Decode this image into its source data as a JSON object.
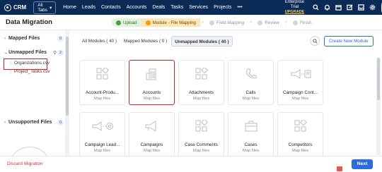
{
  "topbar": {
    "app_name": "CRM",
    "all_tabs_label": "All Tabs",
    "nav_items": [
      "Home",
      "Leads",
      "Contacts",
      "Accounts",
      "Deals",
      "Tasks",
      "Services",
      "Projects",
      "•••"
    ],
    "trial_label": "Enterprise Trial",
    "upgrade_label": "UPGRADE",
    "icons": [
      "search-icon",
      "bell-icon",
      "calendar-icon",
      "compose-icon",
      "inbox-icon",
      "gear-icon",
      "avatar",
      "apps-grid-icon"
    ]
  },
  "page": {
    "title": "Data Migration"
  },
  "steps": [
    {
      "label": "Upload",
      "state": "done"
    },
    {
      "label": "Module - File Mapping",
      "state": "current"
    },
    {
      "label": "Field Mapping",
      "state": "pending"
    },
    {
      "label": "Review",
      "state": "pending"
    },
    {
      "label": "Finish",
      "state": "pending"
    }
  ],
  "sidebar": {
    "mapped": {
      "label": "Mapped Files",
      "count": "0"
    },
    "unmapped": {
      "label": "Unmapped Files",
      "count": "2"
    },
    "unmapped_files": [
      "Organizations.csv",
      "Project_Tasks.csv"
    ],
    "unsupported": {
      "label": "Unsupported Files",
      "count": "0"
    }
  },
  "filters": {
    "all": "All Modules ( 40 )",
    "mapped": "Mapped Modules ( 0 )",
    "unmapped": "Unmapped Modules ( 40 )"
  },
  "create_button": "Create New Module",
  "modules": [
    {
      "name": "Account-Produ...",
      "sub": "Map files",
      "icon": "grid-blocks-icon"
    },
    {
      "name": "Accounts",
      "sub": "Map files",
      "icon": "building-icon"
    },
    {
      "name": "Attachments",
      "sub": "Map files",
      "icon": "grid-blocks-icon"
    },
    {
      "name": "Calls",
      "sub": "Map files",
      "icon": "phone-icon"
    },
    {
      "name": "Campaign Cont...",
      "sub": "Map files",
      "icon": "campaign-contact-icon"
    },
    {
      "name": "Campaign Lead...",
      "sub": "Map files",
      "icon": "campaign-lead-icon"
    },
    {
      "name": "Campaigns",
      "sub": "Map files",
      "icon": "megaphone-icon"
    },
    {
      "name": "Case Comments",
      "sub": "Map files",
      "icon": "grid-blocks-icon"
    },
    {
      "name": "Cases",
      "sub": "Map files",
      "icon": "briefcase-icon"
    },
    {
      "name": "Competitors",
      "sub": "Map files",
      "icon": "grid-blocks-icon"
    }
  ],
  "footer": {
    "discard_label": "Discard Migration",
    "next_label": "Next"
  },
  "colors": {
    "topbar_bg": "#0b2a55",
    "accent": "#2b6de0",
    "highlight": "#e02020"
  }
}
